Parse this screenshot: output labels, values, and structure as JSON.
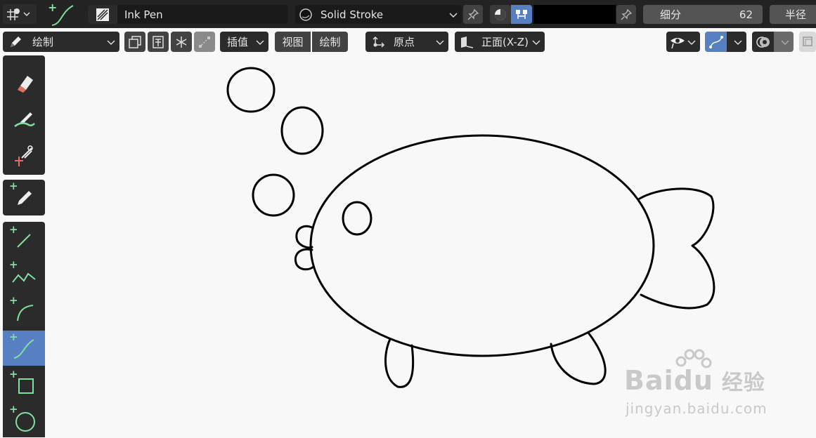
{
  "header": {
    "brush_name": "Ink Pen",
    "material_name": "Solid Stroke",
    "subdivision_label": "细分",
    "subdivision_value": "62",
    "radius_label": "半径"
  },
  "toolbar": {
    "mode_label": "绘制",
    "interpolate_label": "插值",
    "view_label": "视图",
    "draw_label": "绘制",
    "origin_label": "原点",
    "plane_label": "正面(X-Z)"
  },
  "colors": {
    "accent": "#5680c2",
    "panel": "#2b2b2b",
    "header": "#232323",
    "stroke_color": "#000000"
  },
  "sidebar": {
    "tools": [
      "erase-tool",
      "tint-tool",
      "cutter-tool",
      "eyedropper-tool",
      "line-tool",
      "polyline-tool",
      "arc-tool",
      "curve-tool",
      "box-tool",
      "circle-tool"
    ],
    "active_tool": "curve-tool"
  },
  "watermark": {
    "brand": "Baidu",
    "brand_cn": "经验",
    "url": "jingyan.baidu.com"
  }
}
